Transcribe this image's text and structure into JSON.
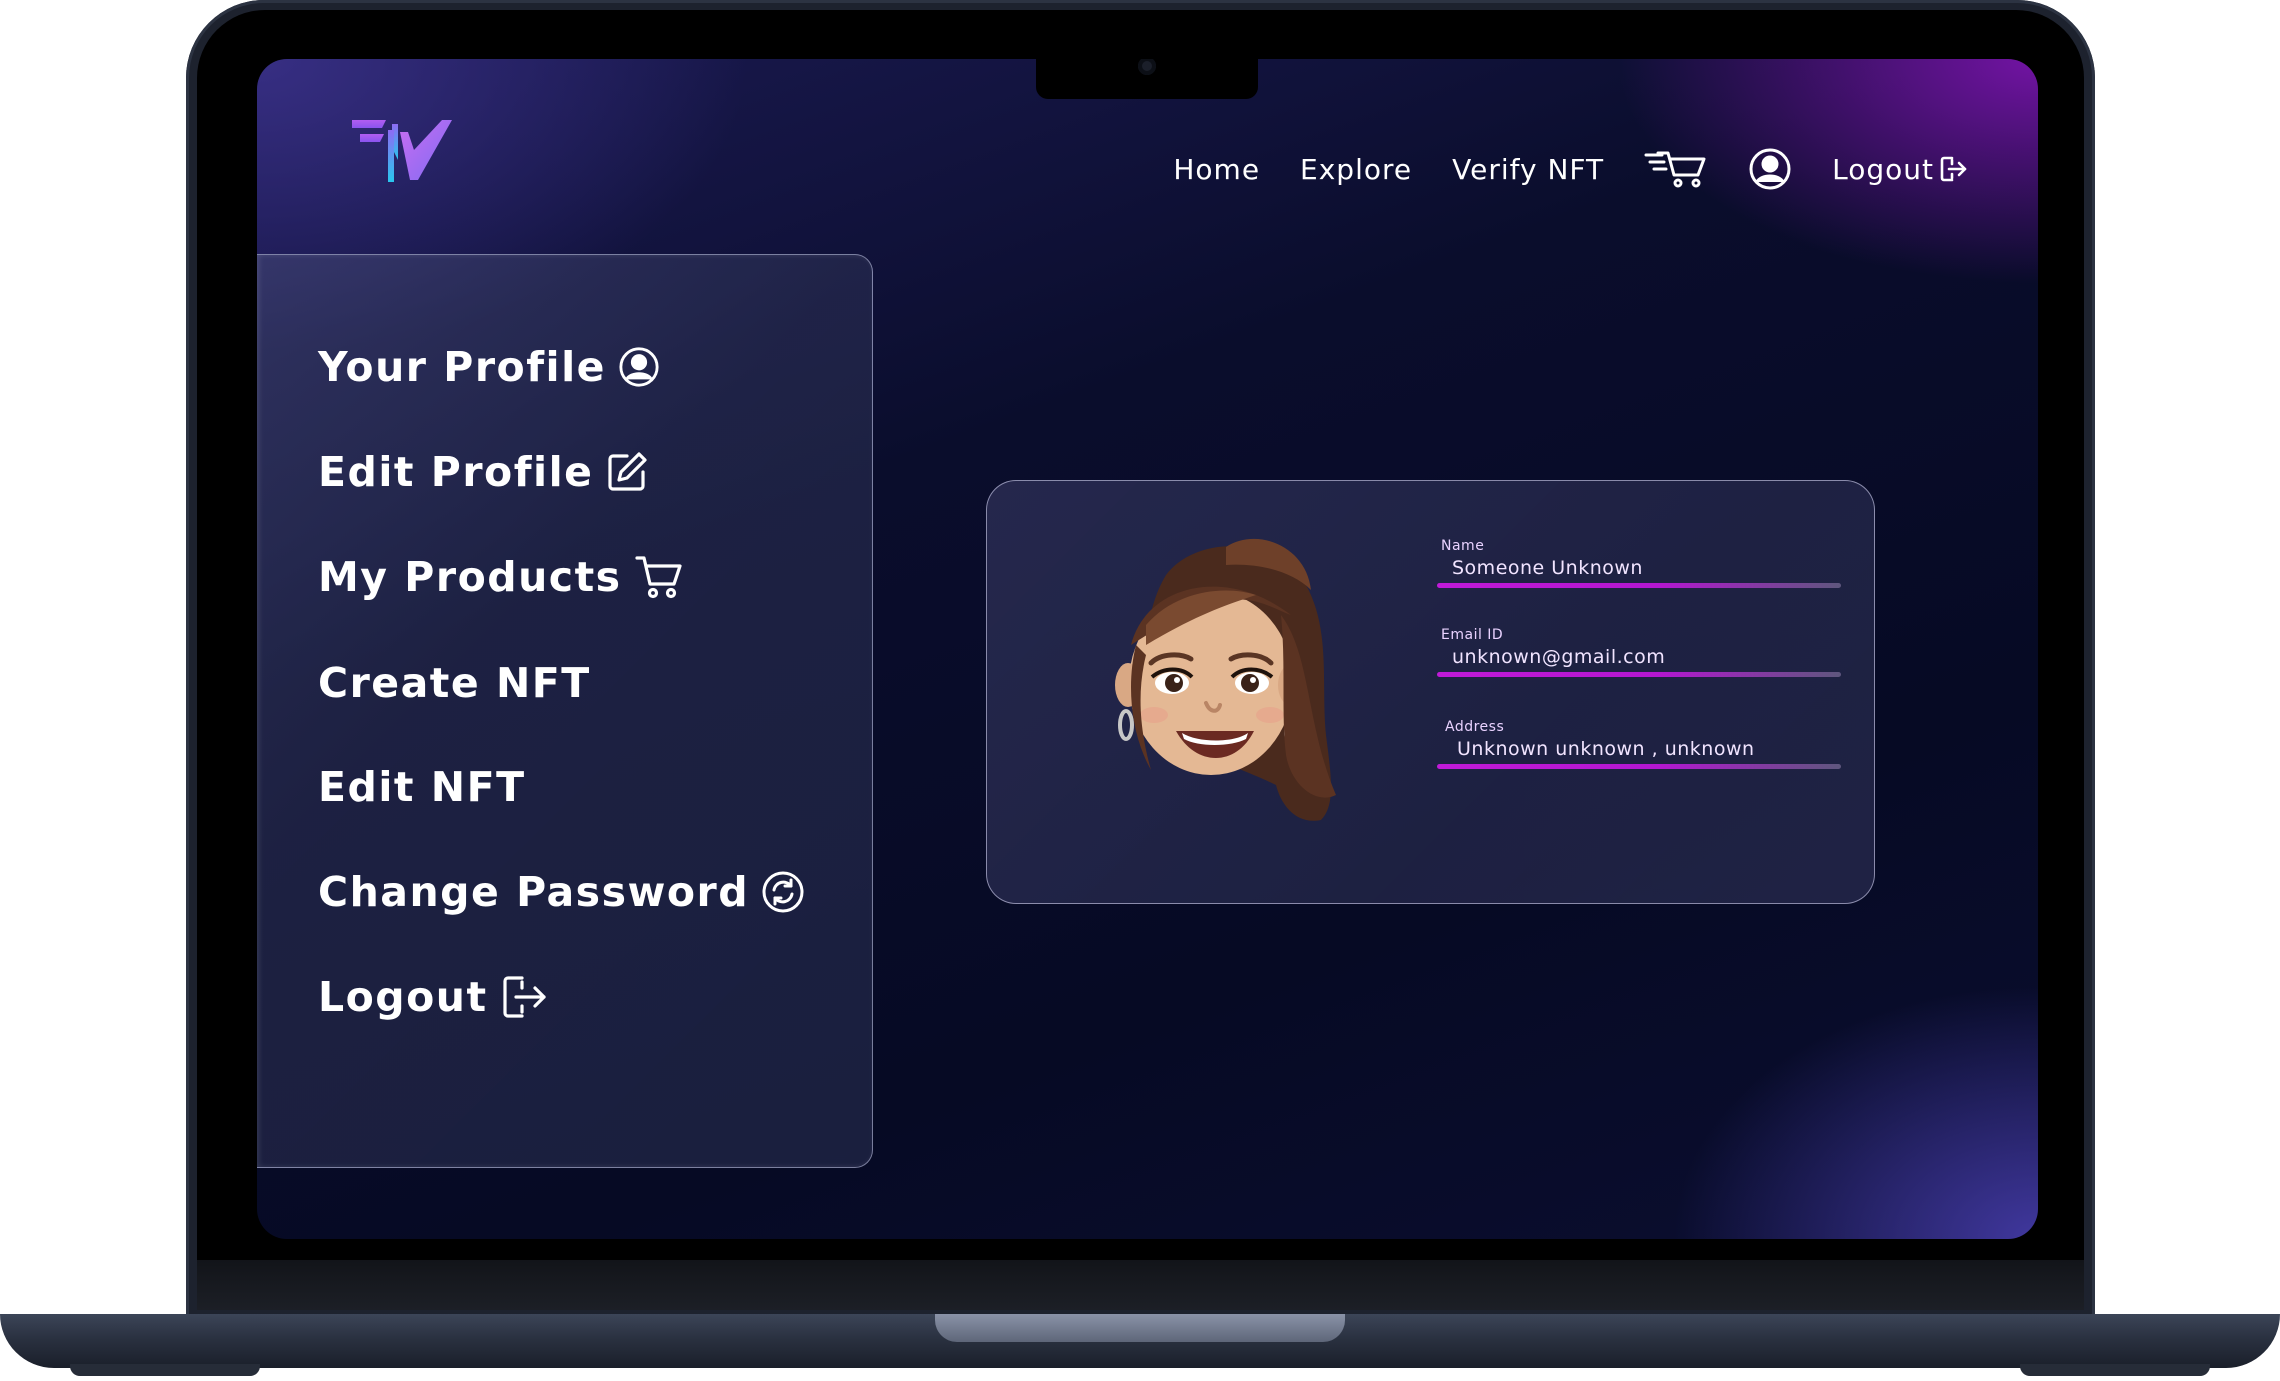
{
  "app": {
    "logo_icon": "fv-logo-icon"
  },
  "nav": {
    "home": "Home",
    "explore": "Explore",
    "verify": "Verify NFT",
    "cart_icon": "cart-icon",
    "user_icon": "user-circle-icon",
    "logout": "Logout",
    "logout_icon": "logout-icon"
  },
  "sidebar": {
    "items": [
      {
        "label": "Your Profile",
        "icon": "user-circle-icon"
      },
      {
        "label": "Edit Profile",
        "icon": "edit-icon"
      },
      {
        "label": "My Products",
        "icon": "cart-icon"
      },
      {
        "label": "Create NFT",
        "icon": ""
      },
      {
        "label": "Edit NFT",
        "icon": ""
      },
      {
        "label": "Change Password",
        "icon": "refresh-icon"
      },
      {
        "label": "Logout",
        "icon": "logout-icon"
      }
    ]
  },
  "profile": {
    "avatar_icon": "memoji-avatar",
    "name_label": "Name",
    "name_value": "Someone Unknown",
    "email_label": "Email ID",
    "email_value": "unknown@gmail.com",
    "address_label": "Address",
    "address_value": "Unknown unknown , unknown"
  },
  "colors": {
    "accent": "#c01ad8",
    "background": "#060a24",
    "text": "#ffffff"
  }
}
